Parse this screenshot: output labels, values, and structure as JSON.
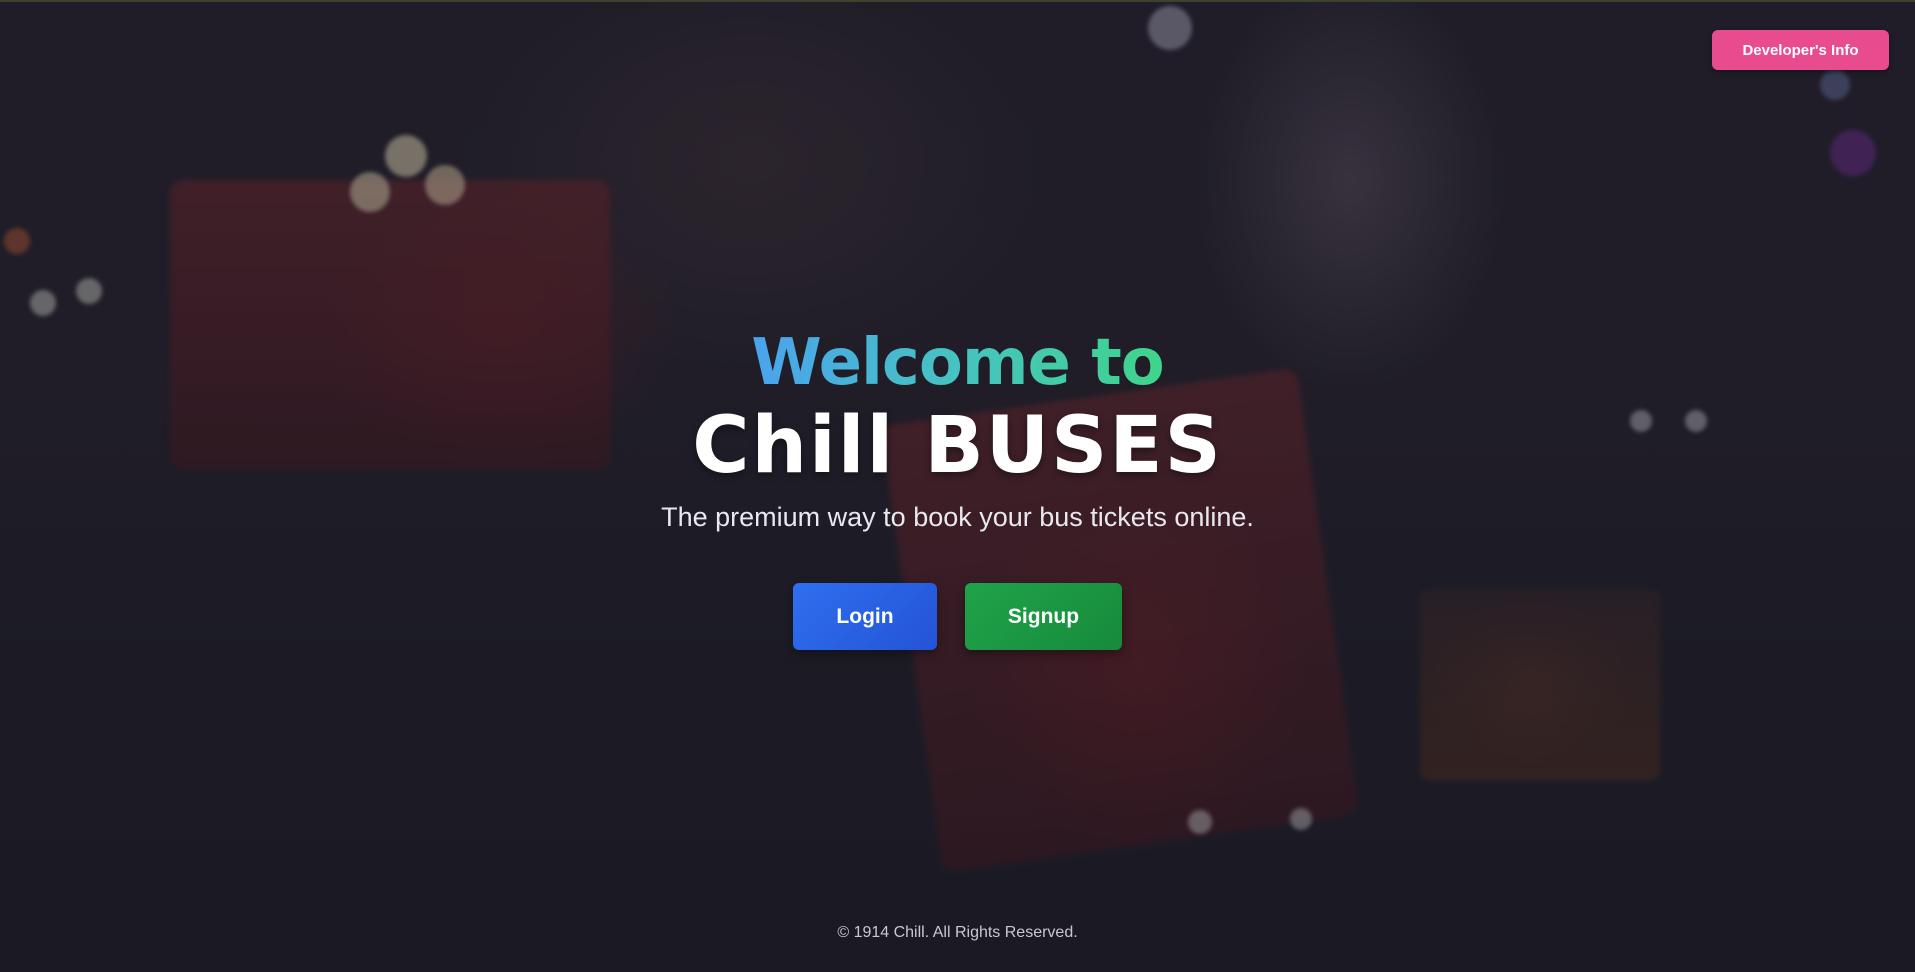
{
  "header": {
    "developer_button_label": "Developer's Info"
  },
  "hero": {
    "welcome": "Welcome to",
    "title": "Chill BUSES",
    "tagline": "The premium way to book your bus tickets online."
  },
  "actions": {
    "login_label": "Login",
    "signup_label": "Signup"
  },
  "footer": {
    "copyright": "© 1914 Chill. All Rights Reserved."
  },
  "colors": {
    "developer_button": "#e94b8f",
    "login_button": "#2f6ff0",
    "signup_button": "#1fa349",
    "welcome_gradient_start": "#4aa3ee",
    "welcome_gradient_end": "#3fd58a"
  }
}
